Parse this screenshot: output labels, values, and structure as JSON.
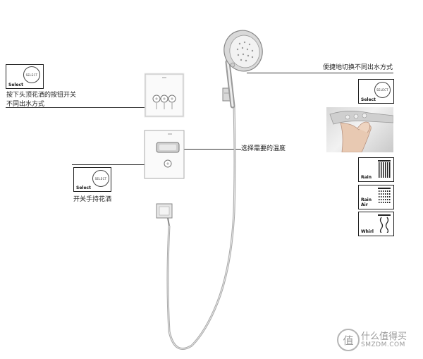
{
  "left_callouts": {
    "select_button_label": "Select",
    "select_circle_text": "SELECT",
    "overhead_text_line1": "按下头顶花洒的按钮开关",
    "overhead_text_line2": "不同出水方式",
    "handheld_text": "开关手持花洒"
  },
  "middle_callout": {
    "temperature_text": "选择需要的温度"
  },
  "right_panel": {
    "switch_text": "便捷地切换不同出水方式",
    "select_button_label": "Select",
    "select_circle_text": "SELECT",
    "modes": [
      {
        "line1": "Rain",
        "line2": ""
      },
      {
        "line1": "Rain",
        "line2": "Air"
      },
      {
        "line1": "Whirl",
        "line2": ""
      }
    ]
  },
  "watermark": {
    "glyph": "值",
    "text_cn": "什么值得买",
    "text_en": "SMZDM.COM"
  },
  "colors": {
    "line": "#333333",
    "chrome": "#b8b8b8",
    "panel_white": "#ffffff"
  }
}
